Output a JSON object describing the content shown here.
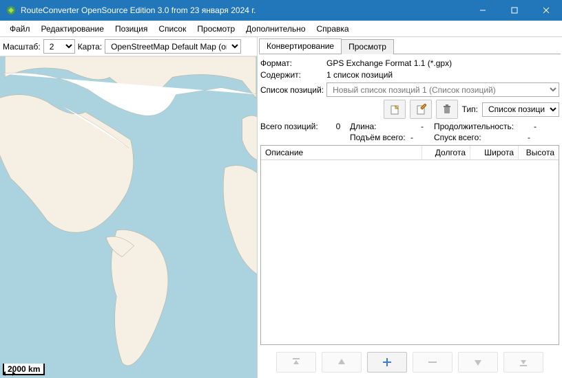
{
  "window": {
    "title": "RouteConverter OpenSource Edition 3.0 from 23 января 2024 г."
  },
  "menu": {
    "file": "Файл",
    "edit": "Редактирование",
    "position": "Позиция",
    "list": "Список",
    "view": "Просмотр",
    "extra": "Дополнительно",
    "help": "Справка"
  },
  "left": {
    "zoom_label": "Масштаб:",
    "zoom_value": "2",
    "map_label": "Карта:",
    "map_value": "OpenStreetMap Default Map (онл…",
    "scale": "2000 km"
  },
  "tabs": {
    "convert": "Конвертирование",
    "view": "Просмотр"
  },
  "info": {
    "format_label": "Формат:",
    "format_value": "GPS Exchange Format 1.1 (*.gpx)",
    "contains_label": "Содержит:",
    "contains_value": "1 список позиций",
    "poslist_label": "Список позиций:",
    "poslist_value": "Новый список позиций 1 (Список позиций)",
    "type_label": "Тип:",
    "type_value": "Список позиций"
  },
  "stats": {
    "total_label": "Всего позиций:",
    "total_value": "0",
    "length_label": "Длина:",
    "length_value": "-",
    "duration_label": "Продолжительность:",
    "duration_value": "-",
    "ascent_label": "Подъём всего:",
    "ascent_value": "-",
    "descent_label": "Спуск всего:",
    "descent_value": "-"
  },
  "table": {
    "desc": "Описание",
    "lon": "Долгота",
    "lat": "Широта",
    "alt": "Высота"
  }
}
